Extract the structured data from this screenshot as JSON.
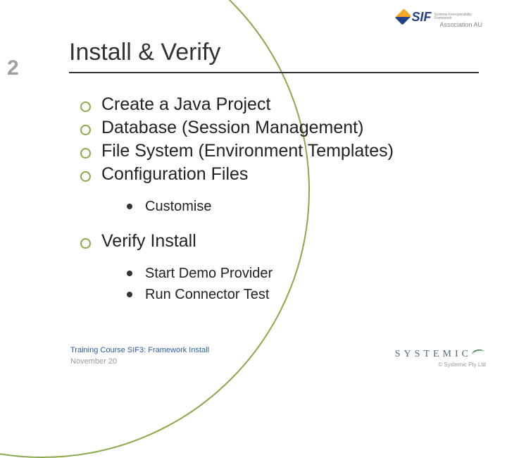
{
  "header_logo": {
    "brand": "SIF",
    "tagline": "Systems Interoperability Framework",
    "subline": "Association AU"
  },
  "slide_number": "2",
  "title": "Install & Verify",
  "bullets": [
    {
      "text": "Create a Java Project"
    },
    {
      "text": "Database (Session Management)"
    },
    {
      "text": "File System (Environment Templates)"
    },
    {
      "text": "Configuration Files",
      "sub": [
        "Customise"
      ]
    },
    {
      "text": "Verify Install",
      "sub": [
        "Start Demo Provider",
        "Run Connector Test"
      ]
    }
  ],
  "footer": {
    "course": "Training Course SIF3: Framework Install",
    "date": "November 20",
    "company_logo_text": "SYSTEMIC",
    "copyright": "© Systemic Pty Ltd"
  }
}
